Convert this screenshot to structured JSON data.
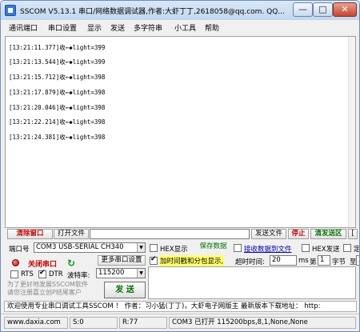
{
  "window": {
    "title": "SSCOM V5.13.1 串口/网络数据调试器,作者:大虾丁丁,2618058@qq.com. QQ...",
    "min_label": "—",
    "max_label": "□",
    "close_label": "✕"
  },
  "menu": [
    "通讯端口",
    "串口设置",
    "显示",
    "发送",
    "多字符串",
    "小工具",
    "帮助"
  ],
  "log": [
    "[13:21:11.377]收←◆light=399",
    "[13:21:13.544]收←◆light=399",
    "[13:21:15.712]收←◆light=398",
    "[13:21:17.879]收←◆light=398",
    "[13:21:20.046]收←◆light=398",
    "[13:21:22.214]收←◆light=398",
    "[13:21:24.381]收←◆light=398"
  ],
  "toolbar": {
    "clear_window": "清除窗口",
    "open_file": "打开文件",
    "send_file": "发送文件",
    "stop": "停止",
    "clear_send": "清发送区",
    "last_cut": "["
  },
  "port": {
    "port_label": "端口号",
    "port_value": "COM3 USB-SERIAL CH340",
    "hex_display": "HEX显示",
    "save_data": "保存数据",
    "receive_to_file": "接收数据到文件",
    "hex_send": "HEX发送",
    "hex_send_cut": "定",
    "close_port": "关闭串口",
    "more_settings": "更多串口设置",
    "timestamp": "加时间戳和分包显示,",
    "timeout_label": "超时时间:",
    "timeout_value": "20",
    "ms": "ms",
    "nth": "第",
    "byte_num": "1",
    "byte_label": "字节",
    "to": "至",
    "to_cut": "末",
    "rts": "RTS",
    "dtr": "DTR",
    "baud_label": "波特率:",
    "baud_value": "115200",
    "promo": "为了更好地发展SSCOM软件 请您注册嘉立创P结尾客户",
    "send": "发 送"
  },
  "marquee": "欢迎使用专业串口调试工具SSCOM ！  作者：习小猛(丁丁)，大虾电子网版主  最新版本下载地址：  http:",
  "status": {
    "site": "www.daxia.com",
    "sent": "S:0",
    "received": "R:77",
    "port_status": "COM3 已打开  115200bps,8,1,None,None"
  }
}
